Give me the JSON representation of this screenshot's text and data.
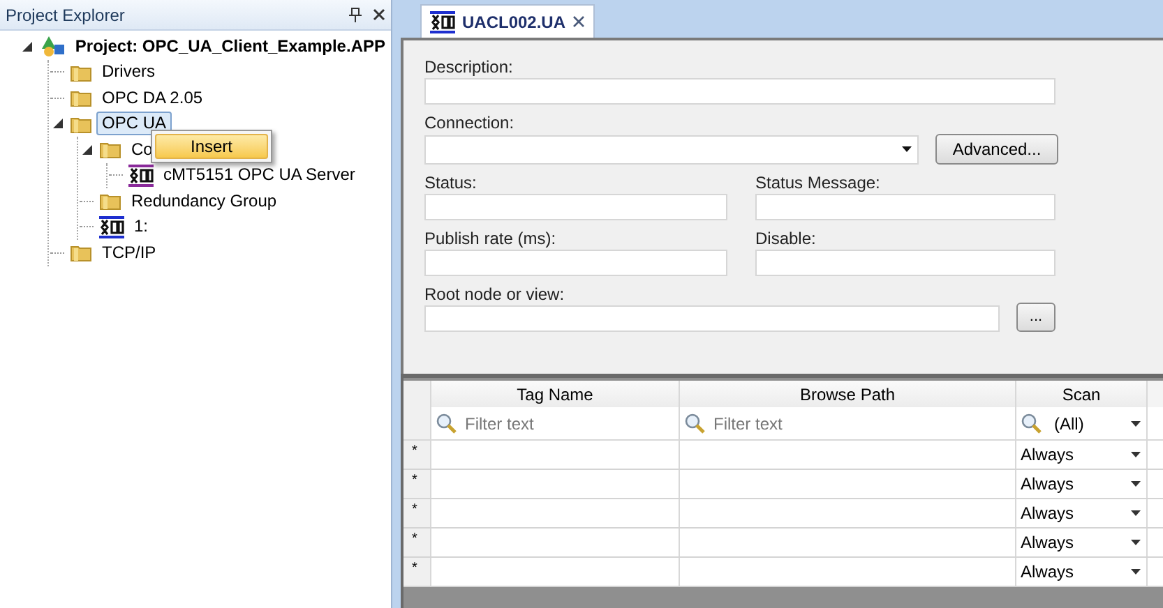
{
  "explorer": {
    "title": "Project Explorer",
    "tree": [
      {
        "label": "Project: OPC_UA_Client_Example.APP",
        "kind": "project",
        "expanded": true,
        "selected": false,
        "children": [
          {
            "label": "Drivers",
            "kind": "folder",
            "selected": false
          },
          {
            "label": "OPC DA 2.05",
            "kind": "folder",
            "selected": false
          },
          {
            "label": "OPC UA",
            "kind": "folder",
            "expanded": true,
            "selected": true,
            "children": [
              {
                "label": "Co",
                "kind": "folder",
                "expanded": true,
                "selected": false,
                "children": [
                  {
                    "label": "cMT5151 OPC UA Server",
                    "kind": "server",
                    "selected": false
                  }
                ]
              },
              {
                "label": "Redundancy Group",
                "kind": "folder",
                "selected": false
              },
              {
                "label": "1:",
                "kind": "client",
                "selected": false
              }
            ]
          },
          {
            "label": "TCP/IP",
            "kind": "folder",
            "selected": false
          }
        ]
      }
    ]
  },
  "context_menu": {
    "items": [
      {
        "label": "Insert"
      }
    ]
  },
  "tabs": [
    {
      "label": "UACL002.UA",
      "selected": true
    }
  ],
  "form": {
    "description": {
      "label": "Description:"
    },
    "connection": {
      "label": "Connection:"
    },
    "advanced_button": "Advanced...",
    "status": {
      "label": "Status:"
    },
    "status_message": {
      "label": "Status Message:"
    },
    "publish_rate": {
      "label": "Publish rate (ms):"
    },
    "disable": {
      "label": "Disable:"
    },
    "root_node": {
      "label": "Root node or view:"
    },
    "browse_button": "..."
  },
  "grid": {
    "columns": [
      "Tag Name",
      "Browse Path",
      "Scan"
    ],
    "filters": [
      {
        "kind": "text",
        "placeholder": "Filter text"
      },
      {
        "kind": "text",
        "placeholder": "Filter text"
      },
      {
        "kind": "select",
        "value": "(All)"
      }
    ],
    "rows": [
      {
        "marker": "*",
        "scan": "Always"
      },
      {
        "marker": "*",
        "scan": "Always"
      },
      {
        "marker": "*",
        "scan": "Always"
      },
      {
        "marker": "*",
        "scan": "Always"
      },
      {
        "marker": "*",
        "scan": "Always"
      }
    ]
  }
}
